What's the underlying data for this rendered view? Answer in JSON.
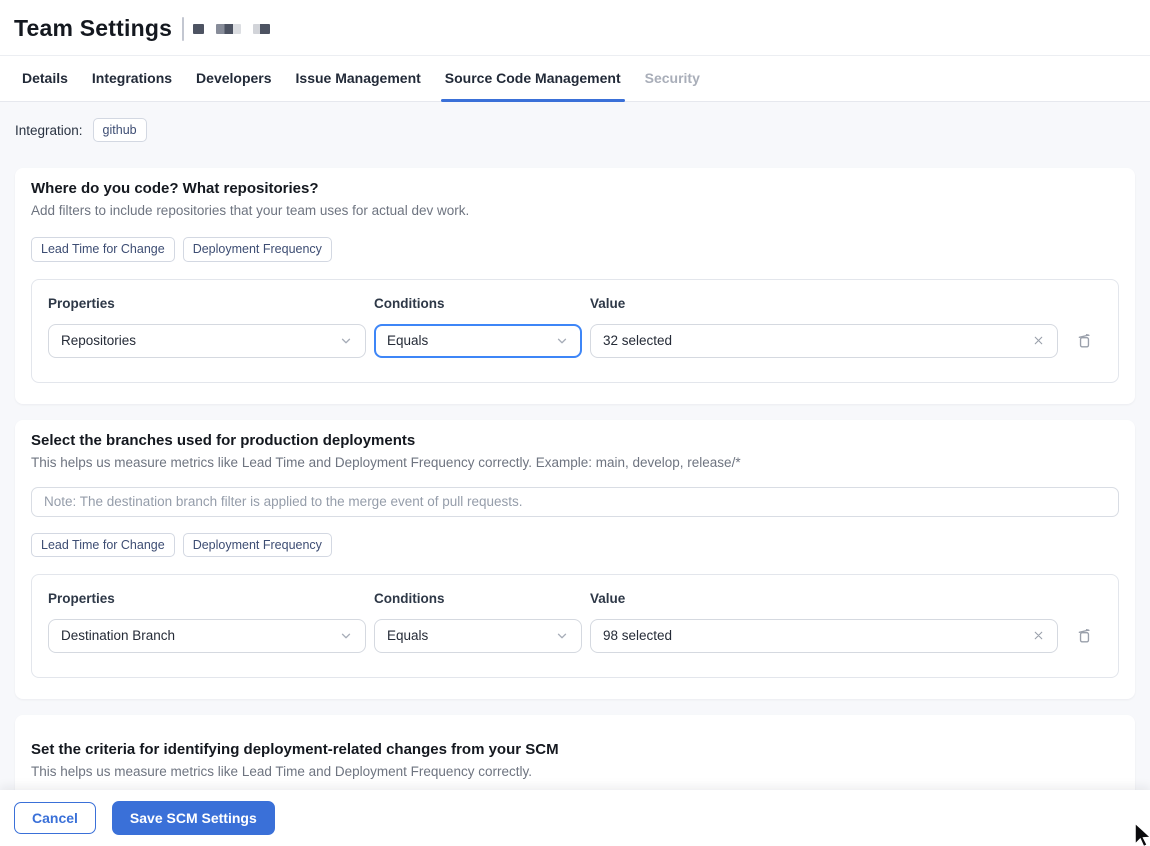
{
  "page": {
    "title": "Team Settings"
  },
  "tabs": {
    "items": [
      {
        "label": "Details",
        "state": "normal"
      },
      {
        "label": "Integrations",
        "state": "normal"
      },
      {
        "label": "Developers",
        "state": "normal"
      },
      {
        "label": "Issue Management",
        "state": "normal"
      },
      {
        "label": "Source Code Management",
        "state": "active"
      },
      {
        "label": "Security",
        "state": "disabled"
      }
    ]
  },
  "integration": {
    "label": "Integration:",
    "value": "github"
  },
  "cards": [
    {
      "heading": "Where do you code? What repositories?",
      "description": "Add filters to include repositories that your team uses for actual dev work.",
      "metric_badges": [
        "Lead Time for Change",
        "Deployment Frequency"
      ],
      "filter": {
        "properties_label": "Properties",
        "conditions_label": "Conditions",
        "value_label": "Value",
        "property": "Repositories",
        "condition": "Equals",
        "condition_focused": true,
        "value": "32 selected"
      }
    },
    {
      "heading": "Select the branches used for production deployments",
      "description": "This helps us measure metrics like Lead Time and Deployment Frequency correctly. Example: main, develop, release/*",
      "note_placeholder": "Note: The destination branch filter is applied to the merge event of pull requests.",
      "metric_badges": [
        "Lead Time for Change",
        "Deployment Frequency"
      ],
      "filter": {
        "properties_label": "Properties",
        "conditions_label": "Conditions",
        "value_label": "Value",
        "property": "Destination Branch",
        "condition": "Equals",
        "condition_focused": false,
        "value": "98 selected"
      }
    },
    {
      "heading": "Set the criteria for identifying deployment-related changes from your SCM",
      "description": "This helps us measure metrics like Lead Time and Deployment Frequency correctly."
    }
  ],
  "footer": {
    "cancel_label": "Cancel",
    "save_label": "Save SCM Settings"
  },
  "colors": {
    "accent_blue": "#3a70d8",
    "focus_blue": "#3e86f7",
    "page_background": "#f7f8fb"
  },
  "icons": {
    "select_caret": "chevron-down-icon",
    "clear_value": "close-icon",
    "remove_filter": "trash-icon",
    "pointer": "mouse-cursor"
  }
}
